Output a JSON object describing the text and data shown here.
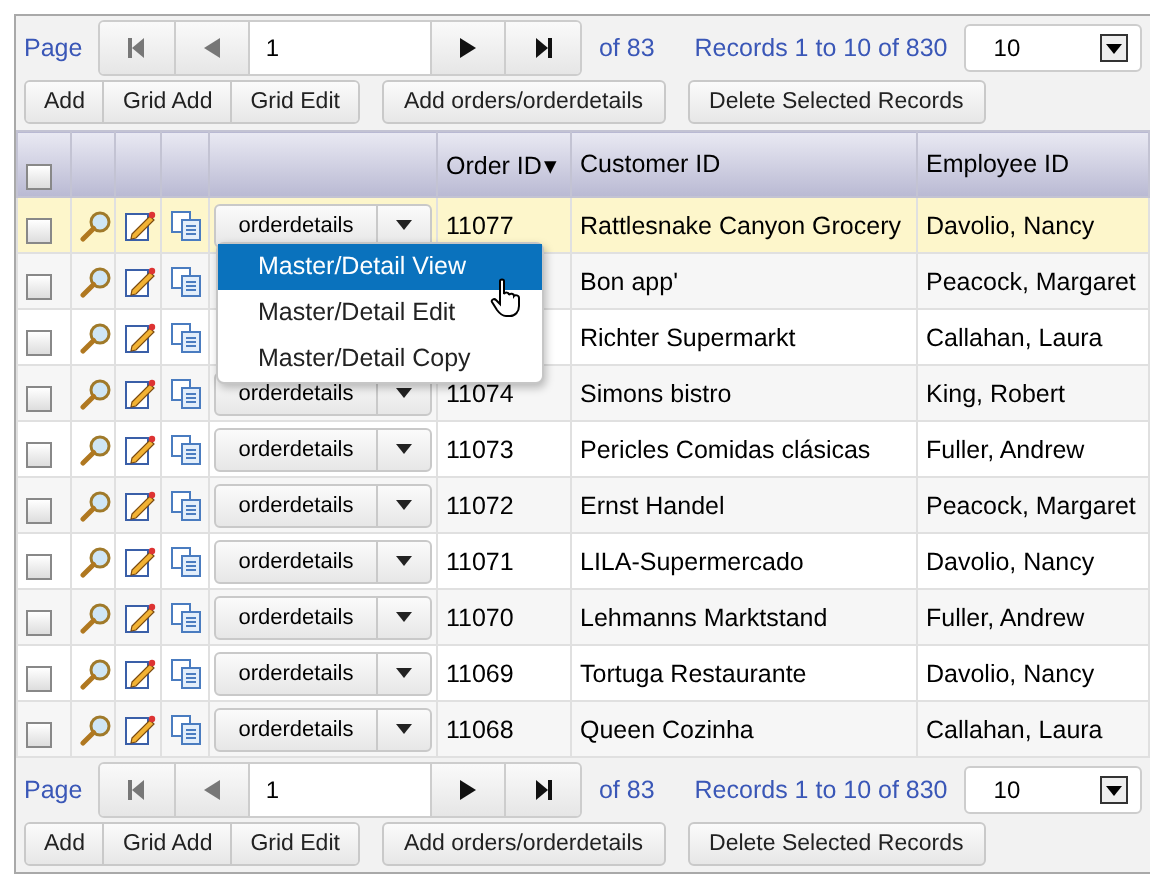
{
  "pager_top": {
    "page_label": "Page",
    "page_value": "1",
    "of_pages": "of 83",
    "records": "Records 1 to 10 of 830",
    "page_size": "10"
  },
  "buttons_top": {
    "group": [
      "Add",
      "Grid Add",
      "Grid Edit"
    ],
    "others": [
      "Add orders/orderdetails",
      "Delete Selected Records"
    ]
  },
  "table": {
    "header_checked": false,
    "columns": [
      "Order ID",
      "Customer ID",
      "Employee ID"
    ],
    "sort_mark": "▾",
    "rows": [
      {
        "dropdown": "orderdetails",
        "order_id": "11077",
        "customer": "Rattlesnake Canyon Grocery",
        "employee": "Davolio, Nancy",
        "selected": true,
        "checked": false
      },
      {
        "customer": "Bon app'",
        "employee": "Peacock, Margaret",
        "selected": false,
        "checked": false
      },
      {
        "customer": "Richter Supermarkt",
        "employee": "Callahan, Laura",
        "selected": false,
        "checked": false
      },
      {
        "dropdown": "orderdetails",
        "order_id": "11074",
        "customer": "Simons bistro",
        "employee": "King, Robert",
        "selected": false,
        "checked": false
      },
      {
        "dropdown": "orderdetails",
        "order_id": "11073",
        "customer": "Pericles Comidas clásicas",
        "employee": "Fuller, Andrew",
        "selected": false,
        "checked": false
      },
      {
        "dropdown": "orderdetails",
        "order_id": "11072",
        "customer": "Ernst Handel",
        "employee": "Peacock, Margaret",
        "selected": false,
        "checked": false
      },
      {
        "dropdown": "orderdetails",
        "order_id": "11071",
        "customer": "LILA-Supermercado",
        "employee": "Davolio, Nancy",
        "selected": false,
        "checked": false
      },
      {
        "dropdown": "orderdetails",
        "order_id": "11070",
        "customer": "Lehmanns Marktstand",
        "employee": "Fuller, Andrew",
        "selected": false,
        "checked": false
      },
      {
        "dropdown": "orderdetails",
        "order_id": "11069",
        "customer": "Tortuga Restaurante",
        "employee": "Davolio, Nancy",
        "selected": false,
        "checked": false
      },
      {
        "dropdown": "orderdetails",
        "order_id": "11068",
        "customer": "Queen Cozinha",
        "employee": "Callahan, Laura",
        "selected": false,
        "checked": false
      }
    ]
  },
  "menu": {
    "items": [
      {
        "label": "Master/Detail View",
        "selected": true
      },
      {
        "label": "Master/Detail Edit",
        "selected": false
      },
      {
        "label": "Master/Detail Copy",
        "selected": false
      }
    ]
  },
  "pager_bottom": {
    "page_label": "Page",
    "page_value": "1",
    "of_pages": "of 83",
    "records": "Records 1 to 10 of 830",
    "page_size": "10"
  },
  "buttons_bottom": {
    "group": [
      "Add",
      "Grid Add",
      "Grid Edit"
    ],
    "others": [
      "Add orders/orderdetails",
      "Delete Selected Records"
    ]
  }
}
